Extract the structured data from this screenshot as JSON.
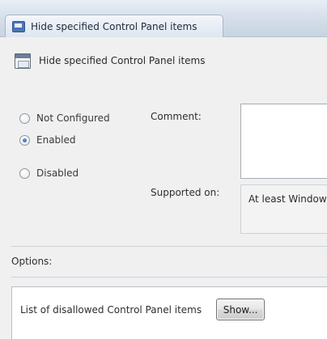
{
  "window": {
    "title": "Hide specified Control Panel items",
    "icon": "policy-window-icon"
  },
  "header": {
    "title": "Hide specified Control Panel items",
    "icon": "policy-setting-icon"
  },
  "state_options": [
    {
      "label": "Not Configured",
      "checked": false
    },
    {
      "label": "Enabled",
      "checked": true
    },
    {
      "label": "Disabled",
      "checked": false
    }
  ],
  "comment": {
    "label": "Comment:",
    "value": ""
  },
  "supported_on": {
    "label": "Supported on:",
    "value": "At least Windows"
  },
  "options": {
    "label": "Options:",
    "items": [
      {
        "label": "List of disallowed Control Panel items",
        "button_label": "Show..."
      }
    ]
  }
}
